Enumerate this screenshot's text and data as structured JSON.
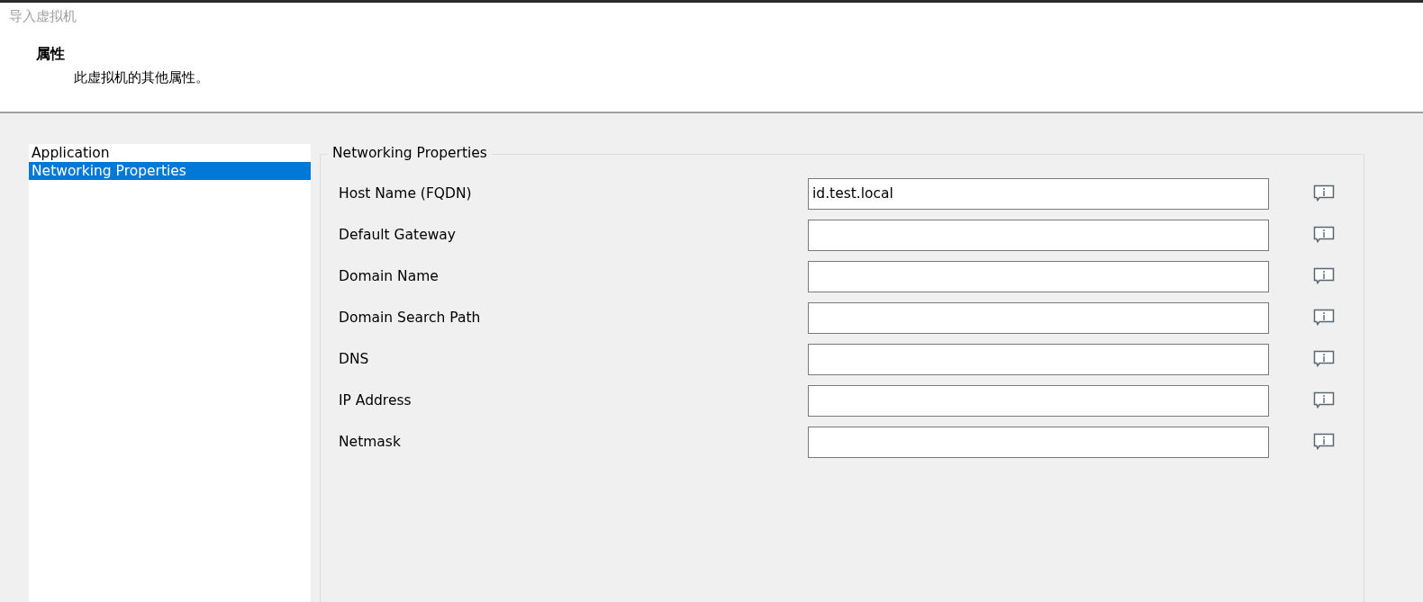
{
  "window": {
    "title": "导入虚拟机"
  },
  "header": {
    "title": "属性",
    "subtitle": "此虚拟机的其他属性。"
  },
  "sidebar": {
    "items": [
      {
        "label": "Application",
        "selected": false
      },
      {
        "label": "Networking Properties",
        "selected": true
      }
    ]
  },
  "group": {
    "title": "Networking Properties",
    "fields": [
      {
        "label": "Host Name (FQDN)",
        "value": "id.test.local"
      },
      {
        "label": "Default Gateway"
      },
      {
        "label": "Domain Name"
      },
      {
        "label": "Domain Search Path"
      },
      {
        "label": "DNS"
      },
      {
        "label": "IP Address"
      },
      {
        "label": "Netmask"
      }
    ]
  }
}
